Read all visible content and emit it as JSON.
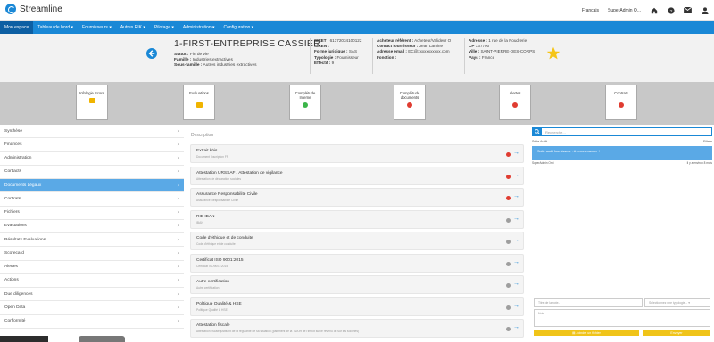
{
  "app": {
    "name": "Streamline",
    "subtitle": ""
  },
  "topbar": {
    "language": "Français",
    "user": "SuperAdmin O...",
    "icons": [
      "home-icon",
      "help-icon",
      "mail-icon",
      "user-icon"
    ]
  },
  "nav": [
    "Mon espace",
    "Tableau de bord",
    "Fournisseurs",
    "Autres RIK",
    "Pilotage",
    "Administration",
    "Configuration"
  ],
  "company": {
    "name": "1-FIRST-ENTREPRISE CASSIER",
    "status_label": "Statut :",
    "status": "Fin de vie",
    "family_label": "Famille :",
    "family": "Industries extractives",
    "subfamily_label": "Sous-famille :",
    "subfamily": "Autres industries extractives"
  },
  "legal": {
    "siret_label": "SIRET :",
    "siret": "61372034100122",
    "siren_label": "SIREN :",
    "siren": "",
    "forme_label": "Forme juridique :",
    "forme": "SAS",
    "typo_label": "Typologie :",
    "typo": "Fournisseur",
    "effectif_label": "Effectif :",
    "effectif": "9"
  },
  "contacts": {
    "buyer_label": "Acheteur référent :",
    "buyer": "Acheteur/Valideur O",
    "supplier_label": "Contact fournisseur :",
    "supplier": "Jean Lamine",
    "email_label": "Adresse email :",
    "email": "EC@xxxxxxxxxxx.com",
    "function_label": "Fonction :",
    "function": ""
  },
  "address": {
    "addr_label": "Adresse :",
    "addr": "1 rue de la Poudrerie",
    "cp_label": "CP :",
    "cp": "37700",
    "city_label": "Ville :",
    "city": "SAINT-PIERRE-DES-CORPS",
    "country_label": "Pays :",
    "country": "France"
  },
  "colors": {
    "accent": "#1a88d6",
    "nav_active": "#0d5fa3",
    "red": "#e03c31",
    "green": "#3cb54a",
    "gray": "#9e9e9e",
    "yellow": "#f0b400"
  },
  "score_cards": [
    {
      "label": "Infologie Score",
      "indicator": "badge",
      "color": "#f0b400"
    },
    {
      "label": "Evaluations",
      "indicator": "badge",
      "color": "#f0b400"
    },
    {
      "label": "Complétude Interne",
      "indicator": "dot",
      "color": "#3cb54a"
    },
    {
      "label": "Complétude documents",
      "indicator": "dot",
      "color": "#e03c31"
    },
    {
      "label": "Alertes",
      "indicator": "dot",
      "color": "#e03c31"
    },
    {
      "label": "Contrats",
      "indicator": "dot",
      "color": "#e03c31"
    }
  ],
  "sidebar": [
    "Synthèse",
    "Finances",
    "Administration",
    "Contacts",
    "Documents Légaux",
    "Contrats",
    "Fichiers",
    "Evaluations",
    "Résultats Evaluations",
    "Scorecard",
    "Alertes",
    "Actions",
    "Due diligences",
    "Open Data",
    "Conformité"
  ],
  "sidebar_active": 4,
  "main": {
    "description_label": "Description",
    "documents": [
      {
        "title": "Extrait kbis",
        "sub": "Document Inscription FR",
        "status": "red"
      },
      {
        "title": "Attestation URSSAF / Attestation de vigilance",
        "sub": "Attestation de déclaration sociales",
        "status": "red"
      },
      {
        "title": "Assurance Responsabilité Civile",
        "sub": "Assurance Responsabilité Civile",
        "status": "red"
      },
      {
        "title": "RIB IBAN",
        "sub": "IBAN",
        "status": "gray"
      },
      {
        "title": "Code d'éthique et de conduite",
        "sub": "Code d'éthique et de conduite",
        "status": "gray"
      },
      {
        "title": "Certificat ISO 9001:2015",
        "sub": "Certificat ISO9001:2015",
        "status": "gray"
      },
      {
        "title": "Autre certification",
        "sub": "Autre certification",
        "status": "gray"
      },
      {
        "title": "Politique Qualité & HSE",
        "sub": "Politique Qualité & HSE",
        "status": "gray"
      },
      {
        "title": "Attestation fiscale",
        "sub": "Attestation fiscale justifiant de la régularité de sa situation (paiement de la TVA et de l'impôt sur le revenu ou sur les sociétés)",
        "status": "gray"
      }
    ]
  },
  "right_panel": {
    "search_placeholder": "Recherche...",
    "feed_left": "Suite Audit",
    "feed_right": "Filtrée",
    "feed_item": "Suite audit fournisseur : A recommander !",
    "feed_author": "SuperAdmin Orbi",
    "feed_time": "Il y a environ 8 mois",
    "title_placeholder": "Titre de la note...",
    "typology_placeholder": "Sélectionnez une typologie...",
    "note_placeholder": "Note...",
    "attach_label": "Joindre un fichier",
    "save_label": "Envoyer"
  }
}
